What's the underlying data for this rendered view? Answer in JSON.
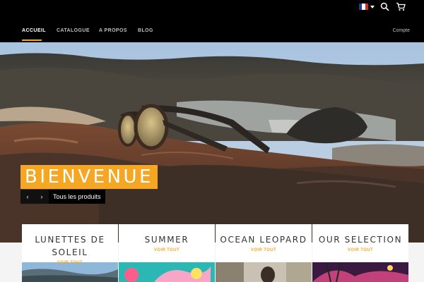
{
  "header": {
    "language_flag_icon": "flag-fr-icon",
    "search_icon": "search-icon",
    "cart_icon": "cart-icon"
  },
  "nav": {
    "items": [
      {
        "label": "ACCUEIL",
        "active": true
      },
      {
        "label": "CATALOGUE",
        "active": false
      },
      {
        "label": "A PROPOS",
        "active": false
      },
      {
        "label": "BLOG",
        "active": false
      }
    ],
    "account_label": "Compte"
  },
  "hero": {
    "title": "BIENVENUE",
    "prev_icon": "‹",
    "next_icon": "›",
    "products_link": "Tous les produits"
  },
  "collections": [
    {
      "title_line1": "LUNETTES DE",
      "title_line2": "SOLEIL",
      "link": "VOIR TOUT"
    },
    {
      "title_line1": "SUMMER",
      "link": "VOIR TOUT"
    },
    {
      "title_line1": "OCEAN LEOPARD",
      "link": "VOIR TOUT"
    },
    {
      "title_line1": "OUR SELECTION",
      "link": "VOIR TOUT"
    }
  ],
  "colors": {
    "accent": "#f5a623",
    "header_bg": "#000000"
  }
}
